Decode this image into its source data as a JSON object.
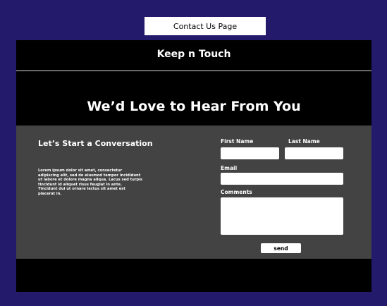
{
  "page_label": "Contact Us Page",
  "site": {
    "title": "Keep n Touch"
  },
  "hero": {
    "heading": "We’d Love to Hear From You"
  },
  "conversation": {
    "heading": "Let’s Start a Conversation",
    "body": "Lorem ipsum dolor sit amet, consectetur adipiscing elit, sed do eiusmod tempor incididunt ut labore et dolore magna aliqua. Lacus sed turpis tincidunt id aliquet risus feugiat in ante. Tincidunt dui ut ornare lectus sit amet est placerat in."
  },
  "form": {
    "first_name_label": "First Name",
    "first_name_value": "",
    "last_name_label": "Last Name",
    "last_name_value": "",
    "email_label": "Email",
    "email_value": "",
    "comments_label": "Comments",
    "comments_value": "",
    "send_label": "send"
  },
  "colors": {
    "background": "#231a6c",
    "frame": "#000000",
    "panel": "#434343",
    "field": "#ffffff",
    "text": "#ffffff"
  }
}
